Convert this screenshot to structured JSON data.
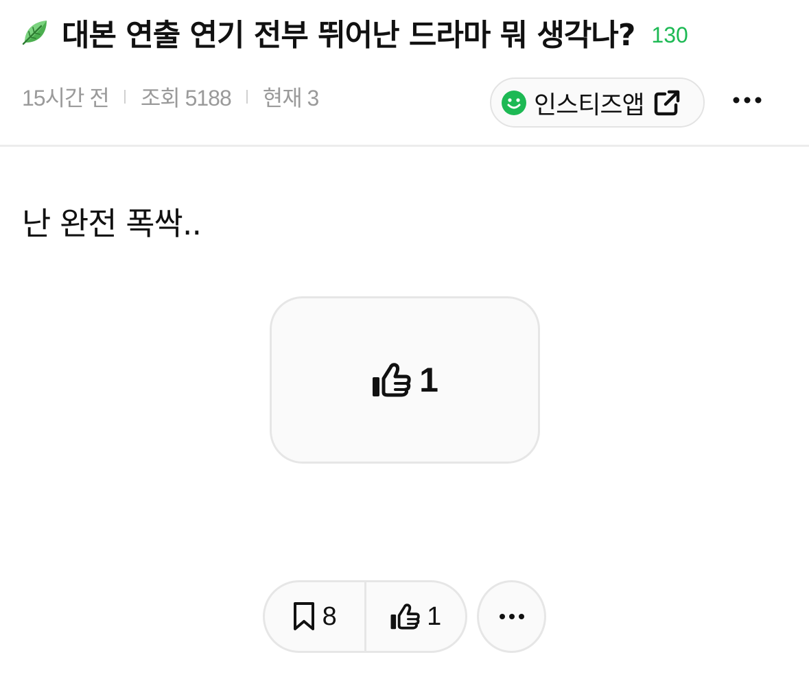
{
  "post": {
    "title": "대본 연출 연기 전부 뛰어난 드라마 뭐 생각나?",
    "comment_count": "130",
    "time_ago": "15시간 전",
    "views": "조회 5188",
    "current": "현재 3",
    "body": "난 완전 폭싹.."
  },
  "app_button": {
    "label": "인스티즈앱"
  },
  "like_box": {
    "count": "1"
  },
  "actions": {
    "bookmark_count": "8",
    "like_count": "1"
  },
  "colors": {
    "accent_green": "#1db954",
    "meta_gray": "#9a9a9a",
    "border_gray": "#e6e6e6"
  },
  "icons": [
    "leaf-icon",
    "smile-icon",
    "external-link-icon",
    "more-icon",
    "thumbs-up-icon",
    "bookmark-icon"
  ]
}
